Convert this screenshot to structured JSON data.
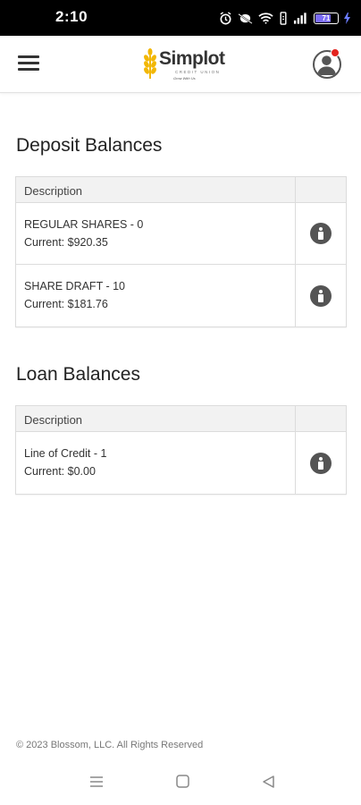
{
  "status_bar": {
    "time": "2:10",
    "battery_level": "71",
    "icons": [
      "alarm-icon",
      "dnd-icon",
      "wifi-icon",
      "vibrate-icon",
      "signal-icon",
      "battery-icon"
    ]
  },
  "header": {
    "brand_name": "Simplot",
    "brand_subtitle": "CREDIT UNION",
    "brand_tagline": "Grow With Us",
    "notification_color": "#e3231e"
  },
  "deposit": {
    "title": "Deposit Balances",
    "column_description": "Description",
    "rows": [
      {
        "name": "REGULAR SHARES - 0",
        "current": "Current: $920.35"
      },
      {
        "name": "SHARE DRAFT - 10",
        "current": "Current: $181.76"
      }
    ]
  },
  "loan": {
    "title": "Loan Balances",
    "column_description": "Description",
    "rows": [
      {
        "name": "Line of Credit - 1",
        "current": "Current: $0.00"
      }
    ]
  },
  "footer": {
    "copyright": "© 2023 Blossom, LLC. All Rights Reserved"
  },
  "accent_colors": {
    "logo_wheat": "#f2b705",
    "icon_gray": "#545454"
  }
}
